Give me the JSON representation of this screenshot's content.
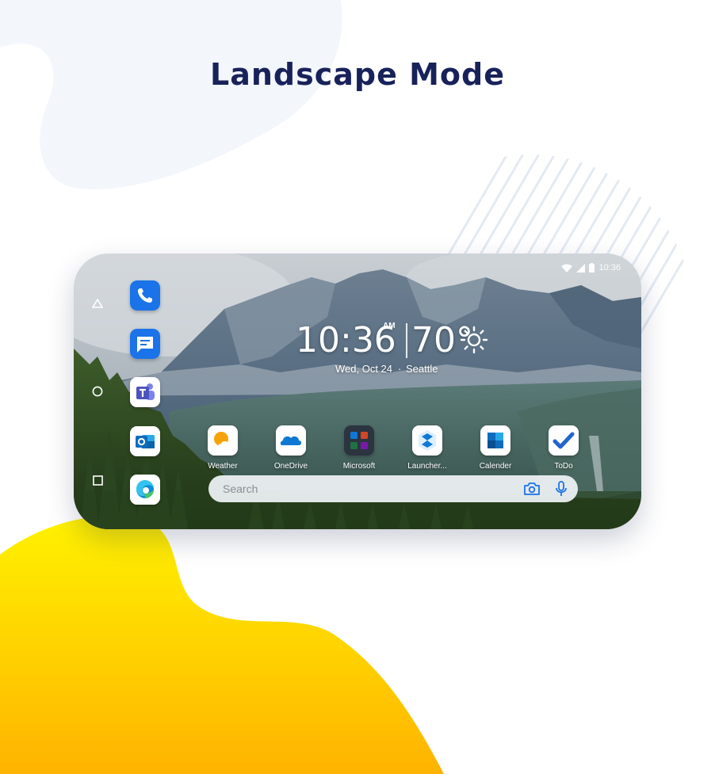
{
  "page": {
    "title": "Landscape Mode"
  },
  "status_bar": {
    "time": "10:36"
  },
  "clock_widget": {
    "time": "10:36",
    "ampm": "AM",
    "temperature": "70°",
    "date": "Wed, Oct 24",
    "separator": "·",
    "city": "Seattle",
    "weather_icon": "sun-icon"
  },
  "nav_bar": {
    "items": [
      "back-icon",
      "home-icon",
      "recents-icon"
    ]
  },
  "dock": {
    "apps": [
      {
        "name": "Phone",
        "icon": "phone-icon"
      },
      {
        "name": "Messages",
        "icon": "messages-icon"
      },
      {
        "name": "Teams",
        "icon": "teams-icon"
      },
      {
        "name": "Outlook",
        "icon": "outlook-icon"
      },
      {
        "name": "Edge",
        "icon": "edge-icon"
      }
    ]
  },
  "home_apps": [
    {
      "label": "Weather",
      "icon": "weather-icon"
    },
    {
      "label": "OneDrive",
      "icon": "onedrive-icon"
    },
    {
      "label": "Microsoft",
      "icon": "microsoft-folder-icon"
    },
    {
      "label": "Launcher...",
      "icon": "launcher-icon"
    },
    {
      "label": "Calender",
      "icon": "calendar-icon"
    },
    {
      "label": "ToDo",
      "icon": "todo-icon"
    }
  ],
  "search": {
    "placeholder": "Search"
  },
  "colors": {
    "title": "#18225a",
    "yellow_blob": "#ffd400",
    "icon_blue": "#1a73e8"
  }
}
